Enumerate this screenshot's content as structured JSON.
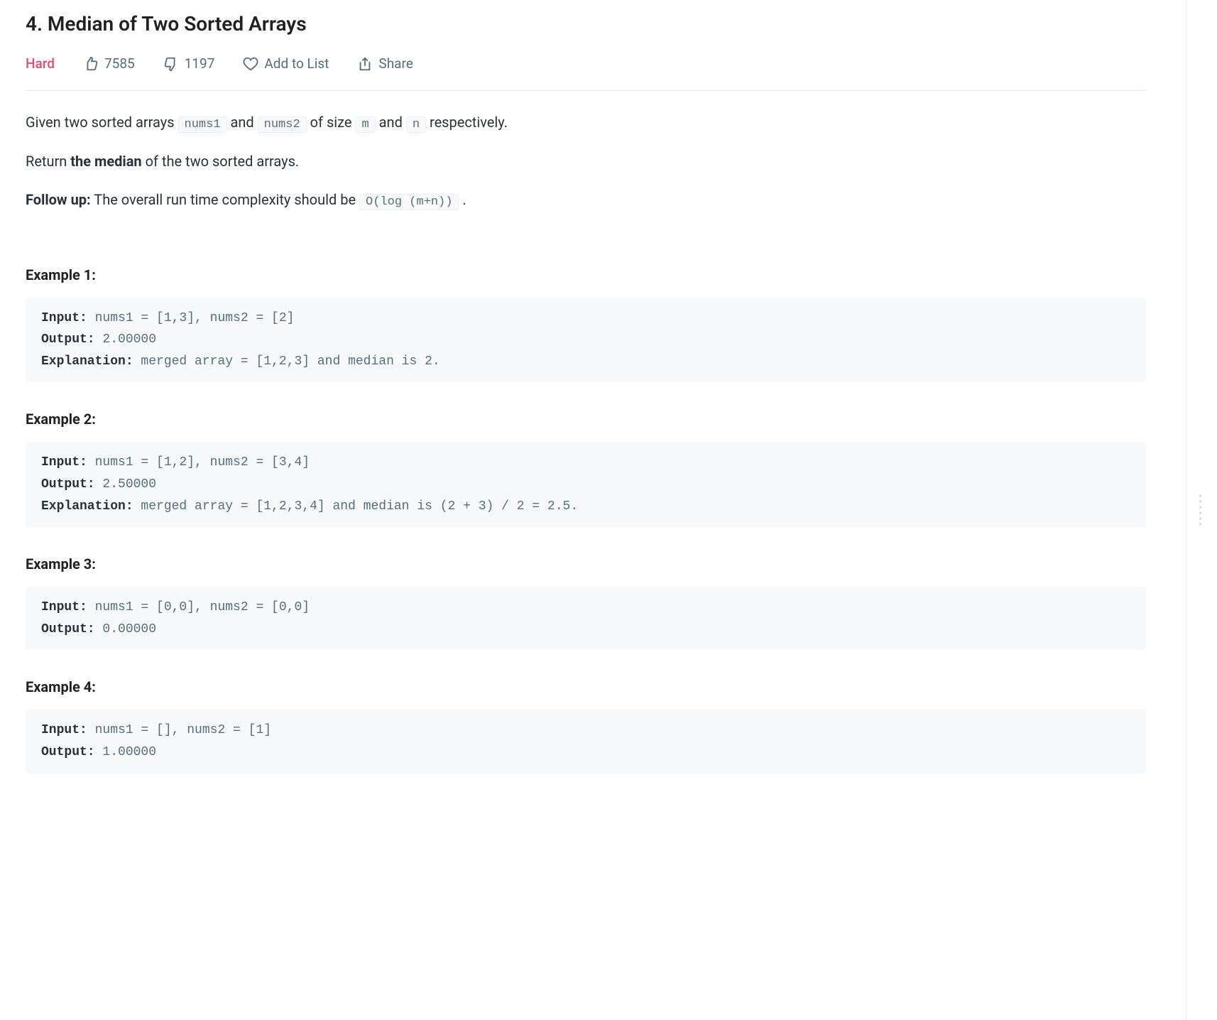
{
  "title": "4. Median of Two Sorted Arrays",
  "meta": {
    "difficulty": "Hard",
    "likes": "7585",
    "dislikes": "1197",
    "addToList": "Add to List",
    "share": "Share"
  },
  "desc": {
    "p1_prefix": "Given two sorted arrays ",
    "p1_code1": "nums1",
    "p1_mid1": " and ",
    "p1_code2": "nums2",
    "p1_mid2": " of size ",
    "p1_code3": "m",
    "p1_mid3": " and ",
    "p1_code4": "n",
    "p1_suffix": " respectively.",
    "p2_prefix": "Return ",
    "p2_strong": "the median",
    "p2_suffix": " of the two sorted arrays.",
    "p3_strong": "Follow up:",
    "p3_mid": " The overall run time complexity should be ",
    "p3_code": "O(log (m+n))",
    "p3_suffix": " ."
  },
  "examples": [
    {
      "heading": "Example 1:",
      "lines": [
        {
          "label": "Input:",
          "value": " nums1 = [1,3], nums2 = [2]"
        },
        {
          "label": "Output:",
          "value": " 2.00000"
        },
        {
          "label": "Explanation:",
          "value": " merged array = [1,2,3] and median is 2."
        }
      ]
    },
    {
      "heading": "Example 2:",
      "lines": [
        {
          "label": "Input:",
          "value": " nums1 = [1,2], nums2 = [3,4]"
        },
        {
          "label": "Output:",
          "value": " 2.50000"
        },
        {
          "label": "Explanation:",
          "value": " merged array = [1,2,3,4] and median is (2 + 3) / 2 = 2.5."
        }
      ]
    },
    {
      "heading": "Example 3:",
      "lines": [
        {
          "label": "Input:",
          "value": " nums1 = [0,0], nums2 = [0,0]"
        },
        {
          "label": "Output:",
          "value": " 0.00000"
        }
      ]
    },
    {
      "heading": "Example 4:",
      "lines": [
        {
          "label": "Input:",
          "value": " nums1 = [], nums2 = [1]"
        },
        {
          "label": "Output:",
          "value": " 1.00000"
        }
      ]
    }
  ]
}
